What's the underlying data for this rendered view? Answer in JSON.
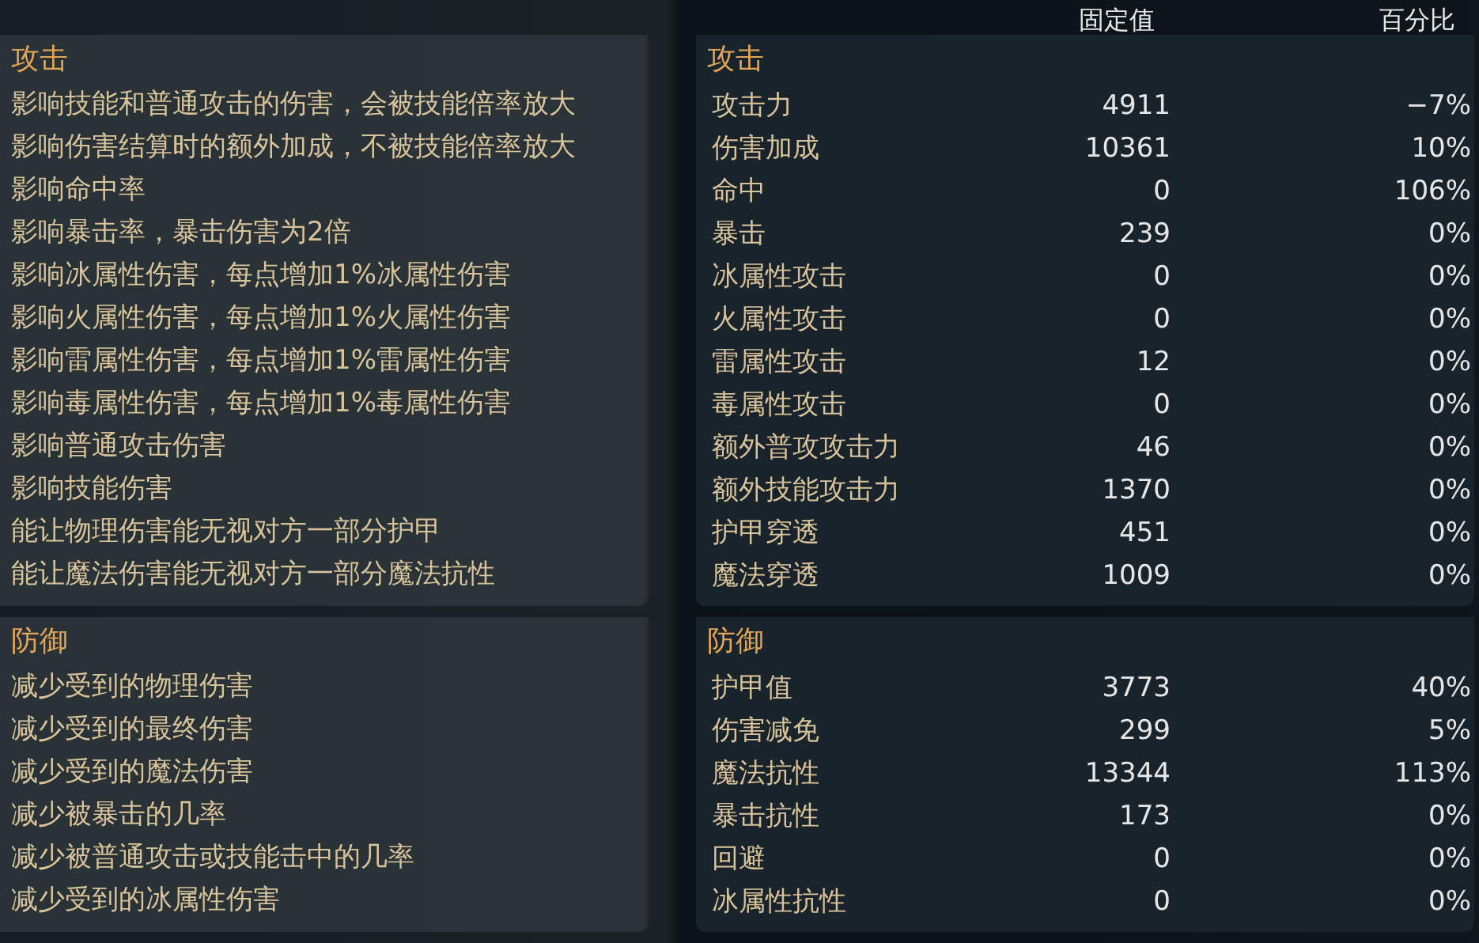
{
  "header": {
    "columns": [
      "固定值",
      "百分比"
    ]
  },
  "sections": [
    {
      "description_title": "攻击",
      "stats_title": "攻击",
      "descriptions": [
        "影响技能和普通攻击的伤害，会被技能倍率放大",
        "影响伤害结算时的额外加成，不被技能倍率放大",
        "影响命中率",
        "影响暴击率，暴击伤害为2倍",
        "影响冰属性伤害，每点增加1%冰属性伤害",
        "影响火属性伤害，每点增加1%火属性伤害",
        "影响雷属性伤害，每点增加1%雷属性伤害",
        "影响毒属性伤害，每点增加1%毒属性伤害",
        "影响普通攻击伤害",
        "影响技能伤害",
        "能让物理伤害能无视对方一部分护甲",
        "能让魔法伤害能无视对方一部分魔法抗性"
      ],
      "stats": [
        {
          "name": "攻击力",
          "value": "4911",
          "percent": "−7%"
        },
        {
          "name": "伤害加成",
          "value": "10361",
          "percent": "10%"
        },
        {
          "name": "命中",
          "value": "0",
          "percent": "106%"
        },
        {
          "name": "暴击",
          "value": "239",
          "percent": "0%"
        },
        {
          "name": "冰属性攻击",
          "value": "0",
          "percent": "0%"
        },
        {
          "name": "火属性攻击",
          "value": "0",
          "percent": "0%"
        },
        {
          "name": "雷属性攻击",
          "value": "12",
          "percent": "0%"
        },
        {
          "name": "毒属性攻击",
          "value": "0",
          "percent": "0%"
        },
        {
          "name": "额外普攻攻击力",
          "value": "46",
          "percent": "0%"
        },
        {
          "name": "额外技能攻击力",
          "value": "1370",
          "percent": "0%"
        },
        {
          "name": "护甲穿透",
          "value": "451",
          "percent": "0%"
        },
        {
          "name": "魔法穿透",
          "value": "1009",
          "percent": "0%"
        }
      ]
    },
    {
      "description_title": "防御",
      "stats_title": "防御",
      "descriptions": [
        "减少受到的物理伤害",
        "减少受到的最终伤害",
        "减少受到的魔法伤害",
        "减少被暴击的几率",
        "减少被普通攻击或技能击中的几率",
        "减少受到的冰属性伤害"
      ],
      "stats": [
        {
          "name": "护甲值",
          "value": "3773",
          "percent": "40%"
        },
        {
          "name": "伤害减免",
          "value": "299",
          "percent": "5%"
        },
        {
          "name": "魔法抗性",
          "value": "13344",
          "percent": "113%"
        },
        {
          "name": "暴击抗性",
          "value": "173",
          "percent": "0%"
        },
        {
          "name": "回避",
          "value": "0",
          "percent": "0%"
        },
        {
          "name": "冰属性抗性",
          "value": "0",
          "percent": "0%"
        }
      ]
    }
  ]
}
